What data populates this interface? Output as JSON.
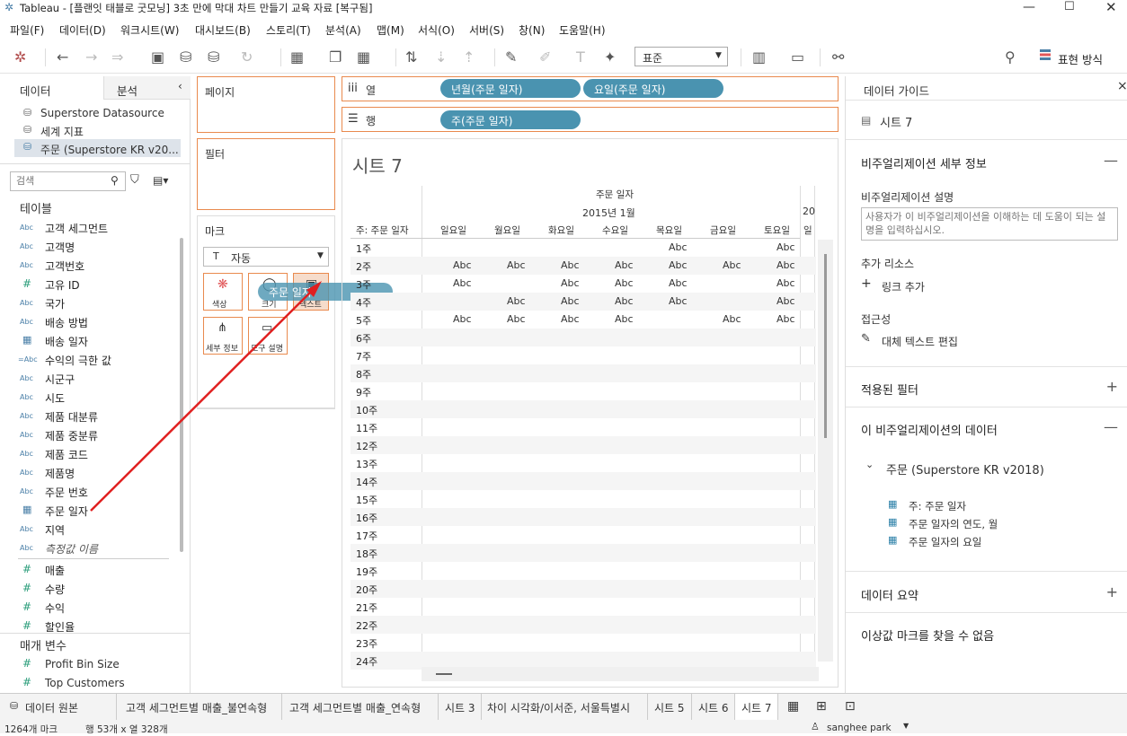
{
  "window": {
    "title": "Tableau - [플랜잇 태블로 굿모닝] 3초 만에 막대 차트 만들기 교육 자료 [복구됨]"
  },
  "menu": [
    "파일(F)",
    "데이터(D)",
    "워크시트(W)",
    "대시보드(B)",
    "스토리(T)",
    "분석(A)",
    "맵(M)",
    "서식(O)",
    "서버(S)",
    "창(N)",
    "도움말(H)"
  ],
  "toolbar": {
    "fit_select": "표준",
    "show_me_label": "표현 방식"
  },
  "left": {
    "tab_data": "데이터",
    "tab_analysis": "분석",
    "sources": [
      "Superstore Datasource",
      "세계 지표",
      "주문 (Superstore KR v20..."
    ],
    "search_placeholder": "검색",
    "tables_label": "테이블",
    "dims": [
      {
        "t": "Abc",
        "n": "고객 세그먼트"
      },
      {
        "t": "Abc",
        "n": "고객명"
      },
      {
        "t": "Abc",
        "n": "고객번호"
      },
      {
        "t": "#",
        "n": "고유 ID"
      },
      {
        "t": "Abc",
        "n": "국가"
      },
      {
        "t": "Abc",
        "n": "배송 방법"
      },
      {
        "t": "cal",
        "n": "배송 일자"
      },
      {
        "t": "=Abc",
        "n": "수익의 극한 값"
      },
      {
        "t": "Abc",
        "n": "시군구"
      },
      {
        "t": "Abc",
        "n": "시도"
      },
      {
        "t": "Abc",
        "n": "제품 대분류"
      },
      {
        "t": "Abc",
        "n": "제품 중분류"
      },
      {
        "t": "Abc",
        "n": "제품 코드"
      },
      {
        "t": "Abc",
        "n": "제품명"
      },
      {
        "t": "Abc",
        "n": "주문 번호"
      },
      {
        "t": "cal",
        "n": "주문 일자"
      },
      {
        "t": "Abc",
        "n": "지역"
      },
      {
        "t": "Abc",
        "n": "측정값 이름"
      }
    ],
    "measures": [
      "매출",
      "수량",
      "수익",
      "할인율"
    ],
    "params_label": "매개 변수",
    "params": [
      "Profit Bin Size",
      "Top Customers"
    ]
  },
  "shelves": {
    "pages": "페이지",
    "filters": "필터",
    "marks": "마크",
    "marks_type": "자동",
    "columns_label": "열",
    "rows_label": "행",
    "col_pills": [
      "년월(주문 일자)",
      "요일(주문 일자)"
    ],
    "row_pills": [
      "주(주문 일자)"
    ],
    "mark_buttons": [
      "색상",
      "크기",
      "텍스트",
      "세부 정보",
      "도구 설명"
    ],
    "drag_pill": "주문 일자"
  },
  "sheet": {
    "title": "시트 7",
    "header_field": "주문 일자",
    "month": "2015년 1월",
    "next_col": "20",
    "row_header": "주: 주문 일자",
    "days": [
      "일요일",
      "월요일",
      "화요일",
      "수요일",
      "목요일",
      "금요일",
      "토요일"
    ],
    "day_cut": "일",
    "weeks": [
      "1주",
      "2주",
      "3주",
      "4주",
      "5주",
      "6주",
      "7주",
      "8주",
      "9주",
      "10주",
      "11주",
      "12주",
      "13주",
      "14주",
      "15주",
      "16주",
      "17주",
      "18주",
      "19주",
      "20주",
      "21주",
      "22주",
      "23주",
      "24주"
    ],
    "cell_text": "Abc",
    "grid": [
      [
        0,
        0,
        0,
        0,
        1,
        0,
        1
      ],
      [
        1,
        1,
        1,
        1,
        1,
        1,
        1
      ],
      [
        1,
        0,
        1,
        1,
        1,
        0,
        1
      ],
      [
        0,
        1,
        1,
        1,
        1,
        0,
        1
      ],
      [
        1,
        1,
        1,
        1,
        0,
        1,
        1
      ]
    ]
  },
  "right": {
    "title": "데이터 가이드",
    "sheet": "시트 7",
    "viz_details": "비주얼리제이션 세부 정보",
    "viz_desc_label": "비주얼리제이션 설명",
    "viz_desc_placeholder": "사용자가 이 비주얼리제이션을 이해하는 데 도움이 되는 설명을 입력하십시오.",
    "resources": "추가 리소스",
    "add_link": "링크 추가",
    "access": "접근성",
    "alt_text": "대체 텍스트 편집",
    "filters": "적용된 필터",
    "viz_data": "이 비주얼리제이션의 데이터",
    "source": "주문 (Superstore KR v2018)",
    "fields": [
      "주: 주문 일자",
      "주문 일자의 연도, 월",
      "주문 일자의 요일"
    ],
    "summary": "데이터 요약",
    "outliers": "이상값 마크를 찾을 수 없음"
  },
  "tabs": [
    "데이터 원본",
    "고객 세그먼트별 매출_불연속형",
    "고객 세그먼트별 매출_연속형",
    "시트 3",
    "차이 시각화/이서준, 서울특별시",
    "시트 5",
    "시트 6",
    "시트 7"
  ],
  "status": {
    "marks": "1264개 마크",
    "rows_cols": "행 53개 x 열 328개",
    "user": "sanghee park"
  }
}
